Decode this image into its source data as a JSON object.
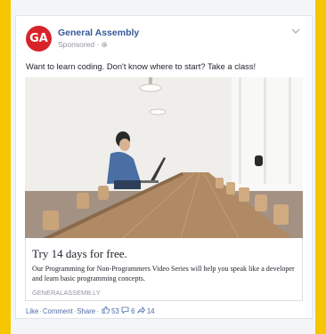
{
  "post": {
    "page_name": "General Assembly",
    "sponsored": "Sponsored · ⊕",
    "avatar_text": "GA",
    "text": "Want to learn coding. Don't know where to start? Take a class!"
  },
  "link": {
    "title": "Try 14 days for free.",
    "description": "Our Programming for Non-Programmers Video Series will help you speak like a developer and learn basic programming concepts.",
    "domain": "GENERALASSEMB.LY"
  },
  "footer": {
    "like": "Like",
    "comment": "Comment",
    "share": "Share",
    "like_count": "53",
    "comment_count": "6",
    "share_count": "14"
  },
  "colors": {
    "brand": "#d8232a",
    "link": "#365899",
    "background": "#f6c600"
  },
  "icons": {
    "menu": "chevron-down-icon",
    "like_count": "thumbs-up-icon",
    "comment_count": "comment-icon",
    "share_count": "share-icon"
  }
}
